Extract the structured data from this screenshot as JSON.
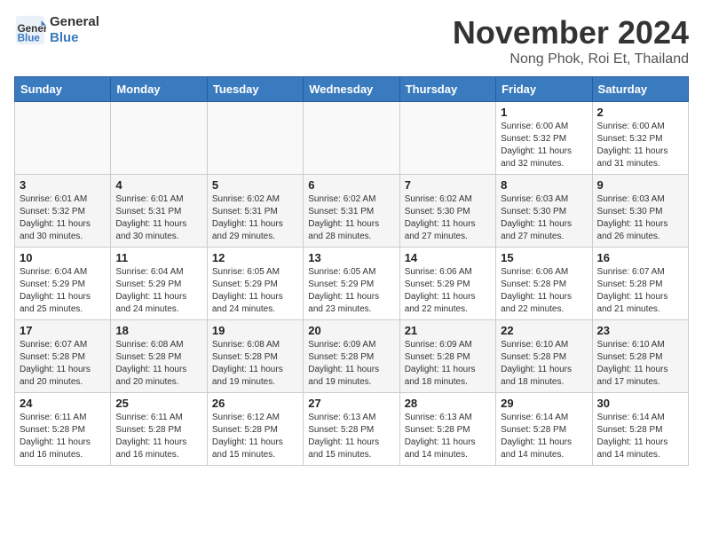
{
  "header": {
    "logo_line1": "General",
    "logo_line2": "Blue",
    "month": "November 2024",
    "location": "Nong Phok, Roi Et, Thailand"
  },
  "weekdays": [
    "Sunday",
    "Monday",
    "Tuesday",
    "Wednesday",
    "Thursday",
    "Friday",
    "Saturday"
  ],
  "weeks": [
    [
      {
        "day": "",
        "info": ""
      },
      {
        "day": "",
        "info": ""
      },
      {
        "day": "",
        "info": ""
      },
      {
        "day": "",
        "info": ""
      },
      {
        "day": "",
        "info": ""
      },
      {
        "day": "1",
        "info": "Sunrise: 6:00 AM\nSunset: 5:32 PM\nDaylight: 11 hours and 32 minutes."
      },
      {
        "day": "2",
        "info": "Sunrise: 6:00 AM\nSunset: 5:32 PM\nDaylight: 11 hours and 31 minutes."
      }
    ],
    [
      {
        "day": "3",
        "info": "Sunrise: 6:01 AM\nSunset: 5:32 PM\nDaylight: 11 hours and 30 minutes."
      },
      {
        "day": "4",
        "info": "Sunrise: 6:01 AM\nSunset: 5:31 PM\nDaylight: 11 hours and 30 minutes."
      },
      {
        "day": "5",
        "info": "Sunrise: 6:02 AM\nSunset: 5:31 PM\nDaylight: 11 hours and 29 minutes."
      },
      {
        "day": "6",
        "info": "Sunrise: 6:02 AM\nSunset: 5:31 PM\nDaylight: 11 hours and 28 minutes."
      },
      {
        "day": "7",
        "info": "Sunrise: 6:02 AM\nSunset: 5:30 PM\nDaylight: 11 hours and 27 minutes."
      },
      {
        "day": "8",
        "info": "Sunrise: 6:03 AM\nSunset: 5:30 PM\nDaylight: 11 hours and 27 minutes."
      },
      {
        "day": "9",
        "info": "Sunrise: 6:03 AM\nSunset: 5:30 PM\nDaylight: 11 hours and 26 minutes."
      }
    ],
    [
      {
        "day": "10",
        "info": "Sunrise: 6:04 AM\nSunset: 5:29 PM\nDaylight: 11 hours and 25 minutes."
      },
      {
        "day": "11",
        "info": "Sunrise: 6:04 AM\nSunset: 5:29 PM\nDaylight: 11 hours and 24 minutes."
      },
      {
        "day": "12",
        "info": "Sunrise: 6:05 AM\nSunset: 5:29 PM\nDaylight: 11 hours and 24 minutes."
      },
      {
        "day": "13",
        "info": "Sunrise: 6:05 AM\nSunset: 5:29 PM\nDaylight: 11 hours and 23 minutes."
      },
      {
        "day": "14",
        "info": "Sunrise: 6:06 AM\nSunset: 5:29 PM\nDaylight: 11 hours and 22 minutes."
      },
      {
        "day": "15",
        "info": "Sunrise: 6:06 AM\nSunset: 5:28 PM\nDaylight: 11 hours and 22 minutes."
      },
      {
        "day": "16",
        "info": "Sunrise: 6:07 AM\nSunset: 5:28 PM\nDaylight: 11 hours and 21 minutes."
      }
    ],
    [
      {
        "day": "17",
        "info": "Sunrise: 6:07 AM\nSunset: 5:28 PM\nDaylight: 11 hours and 20 minutes."
      },
      {
        "day": "18",
        "info": "Sunrise: 6:08 AM\nSunset: 5:28 PM\nDaylight: 11 hours and 20 minutes."
      },
      {
        "day": "19",
        "info": "Sunrise: 6:08 AM\nSunset: 5:28 PM\nDaylight: 11 hours and 19 minutes."
      },
      {
        "day": "20",
        "info": "Sunrise: 6:09 AM\nSunset: 5:28 PM\nDaylight: 11 hours and 19 minutes."
      },
      {
        "day": "21",
        "info": "Sunrise: 6:09 AM\nSunset: 5:28 PM\nDaylight: 11 hours and 18 minutes."
      },
      {
        "day": "22",
        "info": "Sunrise: 6:10 AM\nSunset: 5:28 PM\nDaylight: 11 hours and 18 minutes."
      },
      {
        "day": "23",
        "info": "Sunrise: 6:10 AM\nSunset: 5:28 PM\nDaylight: 11 hours and 17 minutes."
      }
    ],
    [
      {
        "day": "24",
        "info": "Sunrise: 6:11 AM\nSunset: 5:28 PM\nDaylight: 11 hours and 16 minutes."
      },
      {
        "day": "25",
        "info": "Sunrise: 6:11 AM\nSunset: 5:28 PM\nDaylight: 11 hours and 16 minutes."
      },
      {
        "day": "26",
        "info": "Sunrise: 6:12 AM\nSunset: 5:28 PM\nDaylight: 11 hours and 15 minutes."
      },
      {
        "day": "27",
        "info": "Sunrise: 6:13 AM\nSunset: 5:28 PM\nDaylight: 11 hours and 15 minutes."
      },
      {
        "day": "28",
        "info": "Sunrise: 6:13 AM\nSunset: 5:28 PM\nDaylight: 11 hours and 14 minutes."
      },
      {
        "day": "29",
        "info": "Sunrise: 6:14 AM\nSunset: 5:28 PM\nDaylight: 11 hours and 14 minutes."
      },
      {
        "day": "30",
        "info": "Sunrise: 6:14 AM\nSunset: 5:28 PM\nDaylight: 11 hours and 14 minutes."
      }
    ]
  ]
}
